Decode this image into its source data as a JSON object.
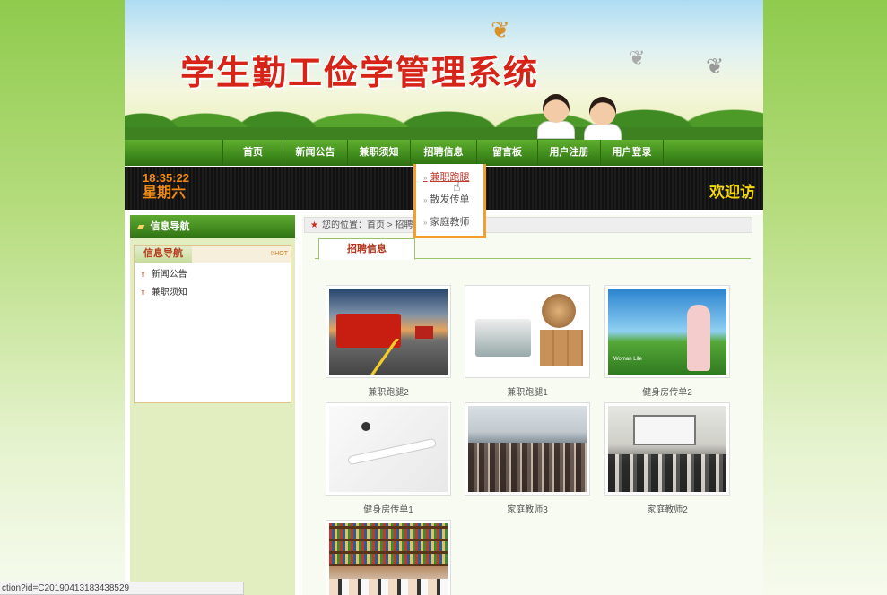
{
  "banner": {
    "title": "学生勤工俭学管理系统"
  },
  "nav": {
    "items": [
      {
        "label": "首页"
      },
      {
        "label": "新闻公告"
      },
      {
        "label": "兼职须知"
      },
      {
        "label": "招聘信息"
      },
      {
        "label": "留言板"
      },
      {
        "label": "用户注册"
      },
      {
        "label": "用户登录"
      }
    ]
  },
  "ticker": {
    "time": "18:35:22",
    "day": "星期六",
    "welcome": "欢迎访"
  },
  "dropdown": {
    "items": [
      {
        "label": "兼职跑腿",
        "active": true
      },
      {
        "label": "散发传单"
      },
      {
        "label": "家庭教师"
      }
    ]
  },
  "sidebar": {
    "header": "信息导航",
    "box_title": "信息导航",
    "hot": "HOT",
    "links": [
      {
        "label": "新闻公告"
      },
      {
        "label": "兼职须知"
      }
    ]
  },
  "content": {
    "breadcrumb": "您的位置：首页 > 招聘信",
    "tab": "招聘信息",
    "gallery": [
      {
        "caption": "兼职跑腿2",
        "image": "truck-highway"
      },
      {
        "caption": "兼职跑腿1",
        "image": "truck-globe-boxes"
      },
      {
        "caption": "健身房传单2",
        "image": "yoga-woman-field"
      },
      {
        "caption": "健身房传单1",
        "image": "yoga-stretch"
      },
      {
        "caption": "家庭教师3",
        "image": "lecture-hall"
      },
      {
        "caption": "家庭教师2",
        "image": "classroom"
      },
      {
        "caption": "",
        "image": "library-class"
      }
    ]
  },
  "statusbar": {
    "text": "ction?id=C20190413183438529"
  }
}
